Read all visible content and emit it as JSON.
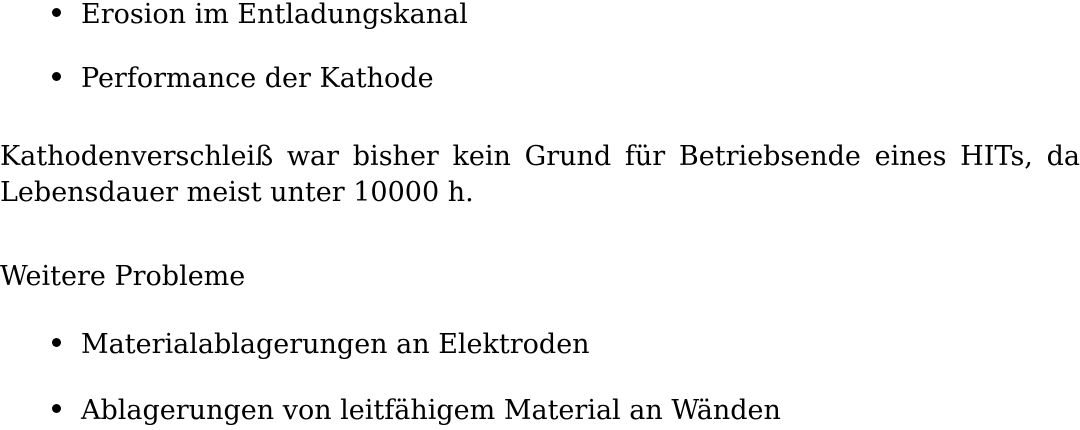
{
  "list1": {
    "items": [
      "Erosion im Entladungskanal",
      "Performance der Kathode"
    ]
  },
  "paragraph": {
    "line1": "Kathodenverschleiß war bisher kein Grund für Betriebsende eines HITs, da",
    "line2": "Lebensdauer meist unter 10000 h."
  },
  "heading": "Weitere Probleme",
  "list2": {
    "items": [
      "Materialablagerungen an Elektroden",
      "Ablagerungen von leitfähigem Material an Wänden"
    ]
  }
}
